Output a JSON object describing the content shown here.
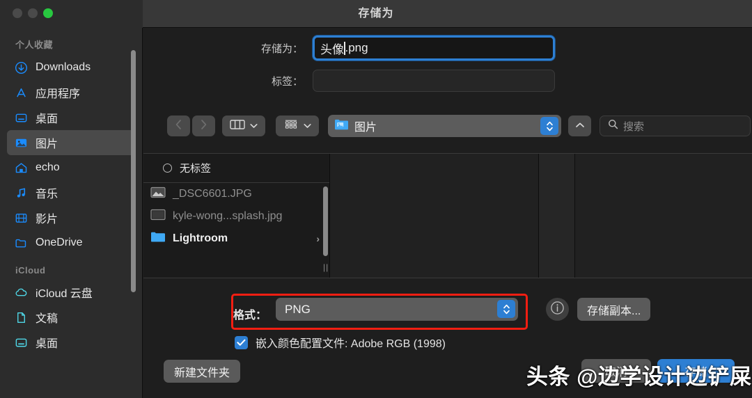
{
  "window": {
    "title": "存储为",
    "traffic_lights": [
      "close",
      "minimize",
      "maximize"
    ]
  },
  "sidebar": {
    "sections": [
      {
        "title": "个人收藏",
        "items": [
          {
            "label": "Downloads",
            "icon": "download-circle-icon",
            "selected": false
          },
          {
            "label": "应用程序",
            "icon": "applications-icon",
            "selected": false
          },
          {
            "label": "桌面",
            "icon": "desktop-icon",
            "selected": false
          },
          {
            "label": "图片",
            "icon": "pictures-icon",
            "selected": true
          },
          {
            "label": "echo",
            "icon": "home-icon",
            "selected": false
          },
          {
            "label": "音乐",
            "icon": "music-note-icon",
            "selected": false
          },
          {
            "label": "影片",
            "icon": "film-icon",
            "selected": false
          },
          {
            "label": "OneDrive",
            "icon": "folder-icon",
            "selected": false
          }
        ]
      },
      {
        "title": "iCloud",
        "items": [
          {
            "label": "iCloud 云盘",
            "icon": "cloud-icon",
            "selected": false
          },
          {
            "label": "文稿",
            "icon": "document-icon",
            "selected": false
          },
          {
            "label": "桌面",
            "icon": "desktop-icon",
            "selected": false
          }
        ]
      }
    ]
  },
  "form": {
    "saveas_label": "存储为：",
    "saveas_value_before_caret": "头像",
    "saveas_value_after_caret": ".png",
    "tags_label": "标签：",
    "tags_value": ""
  },
  "toolbar": {
    "back_icon": "chevron-left-icon",
    "forward_icon": "chevron-right-icon",
    "view_column_icon": "column-view-icon",
    "view_icon_icon": "icon-view-icon",
    "path_label": "图片",
    "path_icon": "pictures-folder-icon",
    "up_icon": "chevron-up-icon",
    "search_placeholder": "搜索",
    "search_icon": "search-icon",
    "search_value": ""
  },
  "browser": {
    "tag_header": "无标签",
    "files": [
      {
        "name": "_DSC6601.JPG",
        "icon": "image-file-icon",
        "state": "dim",
        "has_chevron": false
      },
      {
        "name": "kyle-wong...splash.jpg",
        "icon": "image-file-icon",
        "state": "dim",
        "has_chevron": false
      },
      {
        "name": "Lightroom",
        "icon": "folder-icon",
        "state": "bright",
        "has_chevron": true
      }
    ]
  },
  "format": {
    "label": "格式：",
    "value": "PNG",
    "info_icon": "info-circle-icon",
    "save_copy_label": "存储副本..."
  },
  "options": {
    "embed_profile_label": "嵌入颜色配置文件: Adobe RGB (1998)",
    "embed_profile_checked": true
  },
  "buttons": {
    "new_folder": "新建文件夹",
    "cancel": "取消",
    "save": "存储"
  },
  "watermark": {
    "text": "头条 @边学设计边铲屎"
  },
  "colors": {
    "accent_blue": "#2d7fd3",
    "highlight_red": "#f41e12",
    "sidebar_bg": "#2c2c2c",
    "window_bg": "#1e1e1e",
    "titlebar_bg": "#383838",
    "icon_blue": "#1a8cff",
    "icon_cyan": "#4fd8e8",
    "traffic_green": "#28c840"
  }
}
